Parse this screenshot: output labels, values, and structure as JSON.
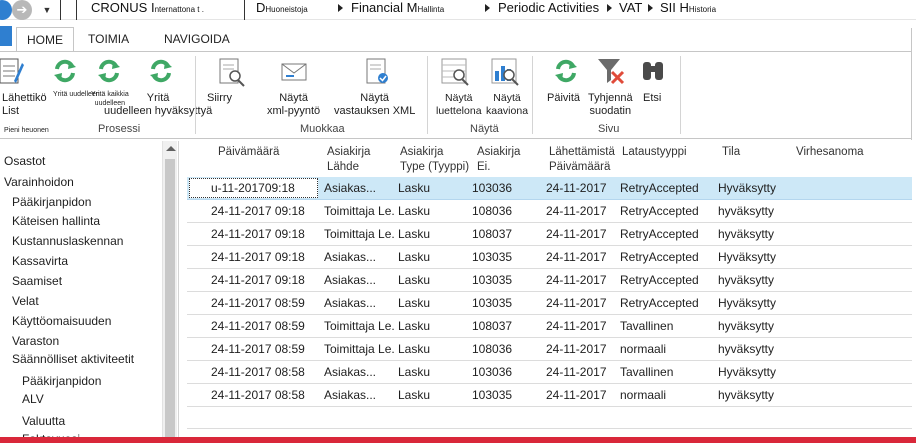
{
  "addressbar": {
    "company": "CRONUS I",
    "company_sub": "nternattona t .",
    "dept_prefix": "D",
    "dept_sub": "Huoneistoja",
    "financial": "Financial M",
    "financial_sub": "Hallinta",
    "periodic": "Periodic Activities",
    "vat": "VAT",
    "sii": "SII H",
    "sii_sub": "Historia"
  },
  "tabs": {
    "home": "HOME",
    "actions": "TOIMIA",
    "navigate": "NAVIGOIDA"
  },
  "ribbon": {
    "send_list": "Lähettikö\nList",
    "retry_small": "Yritä uudelleen",
    "retry_all_small": "Yritä kaikkia\nuudelleen",
    "retry_again": "Yritä\nuudelleen hyväksyttyä",
    "small_button": "Pieni heuonen",
    "group_process": "Prosessi",
    "move": "Siirry",
    "show_xml_request": "Näytä\nxml-pyyntö",
    "show_xml_response": "Näytä\nvastauksen XML",
    "group_edit": "Muokkaa",
    "show_list": "Näytä\nluettelona",
    "show_chart": "Näytä\nkaaviona",
    "group_view": "Näytä",
    "refresh": "Päivitä",
    "clear_filter": "Tyhjennä\nsuodatin",
    "find": "Etsi",
    "group_page": "Sivu"
  },
  "leftnav": {
    "items": [
      "Osastot",
      "Varainhoidon",
      "Pääkirjanpidon",
      "Käteisen hallinta",
      "Kustannuslaskennan",
      "Kassavirta",
      "Saamiset",
      "Velat",
      "Käyttöomaisuuden",
      "Varaston",
      "Säännölliset aktiviteetit",
      "Pääkirjanpidon",
      "ALV",
      "Valuutta",
      "Faktavuosi"
    ]
  },
  "table": {
    "headers": [
      "Päivämäärä",
      "Asiakirja\nLähde",
      "Asiakirja\nType (Tyyppi)",
      "Asiakirja\nEi.",
      "Lähettämistä\nPäivämäärä",
      "Lataustyyppi",
      "Tila",
      "Virhesanoma"
    ],
    "rows": [
      [
        "u-11-201709:18",
        "Asiakas...",
        "Lasku",
        "103036",
        "24-11-2017",
        "RetryAccepted",
        "Hyväksytty",
        ""
      ],
      [
        "24-11-2017 09:18",
        "Toimittaja Le...",
        "Lasku",
        "108036",
        "24-11-2017",
        "RetryAccepted",
        "hyväksytty",
        ""
      ],
      [
        "24-11-2017 09:18",
        "Toimittaja Le...",
        "Lasku",
        "108037",
        "24-11-2017",
        "RetryAccepted",
        "hyväksytty",
        ""
      ],
      [
        "24-11-2017 09:18",
        "Asiakas...",
        "Lasku",
        "103035",
        "24-11-2017",
        "RetryAccepted",
        "Hyväksytty",
        ""
      ],
      [
        "24-11-2017 09:18",
        "Asiakas...",
        "Lasku",
        "103035",
        "24-11-2017",
        "RetryAccepted",
        "hyväksytty",
        ""
      ],
      [
        "24-11-2017 08:59",
        "Asiakas...",
        "Lasku",
        "103035",
        "24-11-2017",
        "RetryAccepted",
        "Hyväksytty",
        ""
      ],
      [
        "24-11-2017 08:59",
        "Toimittaja Le...",
        "Lasku",
        "108037",
        "24-11-2017",
        "Tavallinen",
        "hyväksytty",
        ""
      ],
      [
        "24-11-2017 08:59",
        "Toimittaja Le...",
        "Lasku",
        "108036",
        "24-11-2017",
        "normaali",
        "hyväksytty",
        ""
      ],
      [
        "24-11-2017 08:58",
        "Asiakas...",
        "Lasku",
        "103036",
        "24-11-2017",
        "Tavallinen",
        "Hyväksytty",
        ""
      ],
      [
        "24-11-2017 08:58",
        "Asiakas...",
        "Lasku",
        "103035",
        "24-11-2017",
        "normaali",
        "hyväksytty",
        ""
      ]
    ]
  },
  "colors": {
    "accent": "#2f7fd0",
    "selection": "#cde8f7",
    "refresh_green": "#3fa865",
    "filter_red": "#e04b3a"
  }
}
